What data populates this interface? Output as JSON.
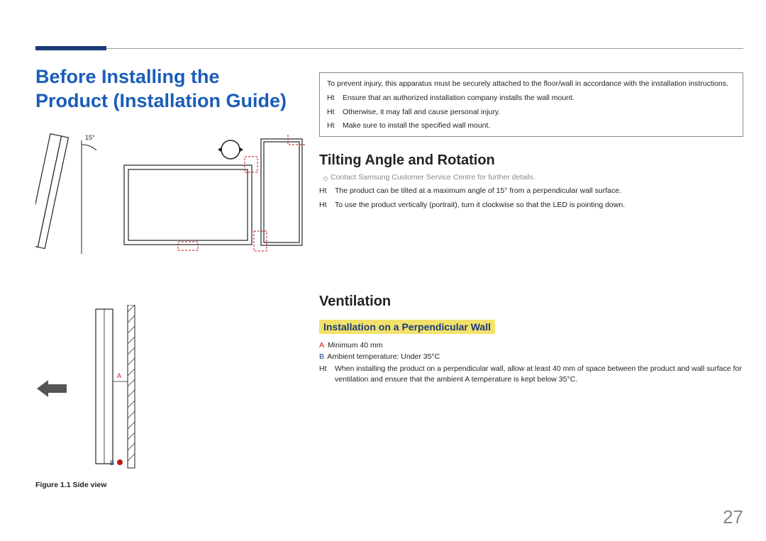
{
  "page": {
    "title": "Before Installing the Product (Installation Guide)",
    "number": "27"
  },
  "warning_box": {
    "intro": "To prevent injury, this apparatus must be securely attached to the floor/wall in accordance with the installation instructions.",
    "items": [
      {
        "tag": "Ht",
        "text": "Ensure that an authorized installation company installs the wall mount."
      },
      {
        "tag": "Ht",
        "text": "Otherwise, it may fall and cause personal injury."
      },
      {
        "tag": "Ht",
        "text": "Make sure to install the specified wall mount."
      }
    ]
  },
  "tilting": {
    "heading": "Tilting Angle and Rotation",
    "note": "Contact Samsung Customer Service Centre for further details.",
    "items": [
      {
        "tag": "Ht",
        "text": "The product can be tilted at a maximum angle of 15° from a perpendicular wall surface."
      },
      {
        "tag": "Ht",
        "text": "To use the product vertically (portrait), turn it clockwise so that the LED is pointing down."
      }
    ]
  },
  "ventilation": {
    "heading": "Ventilation",
    "sub": "Installation on a Perpendicular Wall",
    "spec_a_label": "A",
    "spec_a": "Minimum 40 mm",
    "spec_b_label": "B",
    "spec_b": "Ambient temperature: Under 35°C",
    "items": [
      {
        "tag": "Ht",
        "text": "When installing the product on a perpendicular wall, allow at least 40 mm of space between the product and wall surface for ventilation and ensure that the ambient A temperature is kept below 35°C."
      }
    ]
  },
  "figures": {
    "top_angle_label": "15°",
    "bottom_caption": "Figure 1.1 Side view",
    "label_a": "A",
    "label_b": "B"
  }
}
